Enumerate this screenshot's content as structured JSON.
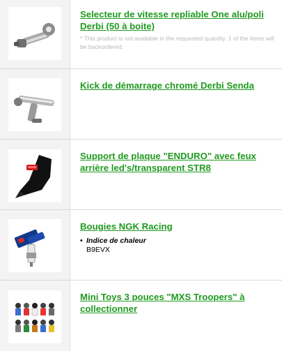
{
  "products": [
    {
      "title": "Selecteur de vitesse repliable One alu/poli Derbi (50 à boite)",
      "note": "* This product is not available in the requested quantity. 1 of the items will be backordered.",
      "image": "gear-selector-lever-image"
    },
    {
      "title": "Kick de démarrage chromé Derbi Senda",
      "image": "kickstart-lever-image"
    },
    {
      "title": "Support de plaque \"ENDURO\" avec feux arrière led's/transparent STR8",
      "image": "rear-fender-plate-image"
    },
    {
      "title": "Bougies NGK Racing",
      "attribute": {
        "name": "Indice de chaleur",
        "value": "B9EVX"
      },
      "image": "spark-plug-image"
    },
    {
      "title": "Mini Toys 3 pouces \"MXS Troopers\" à collectionner",
      "image": "mini-toys-figures-image"
    }
  ],
  "colors": {
    "link": "#1f9a1f",
    "note": "#b8b8b8",
    "thumb_bg": "#f3f3f3"
  }
}
